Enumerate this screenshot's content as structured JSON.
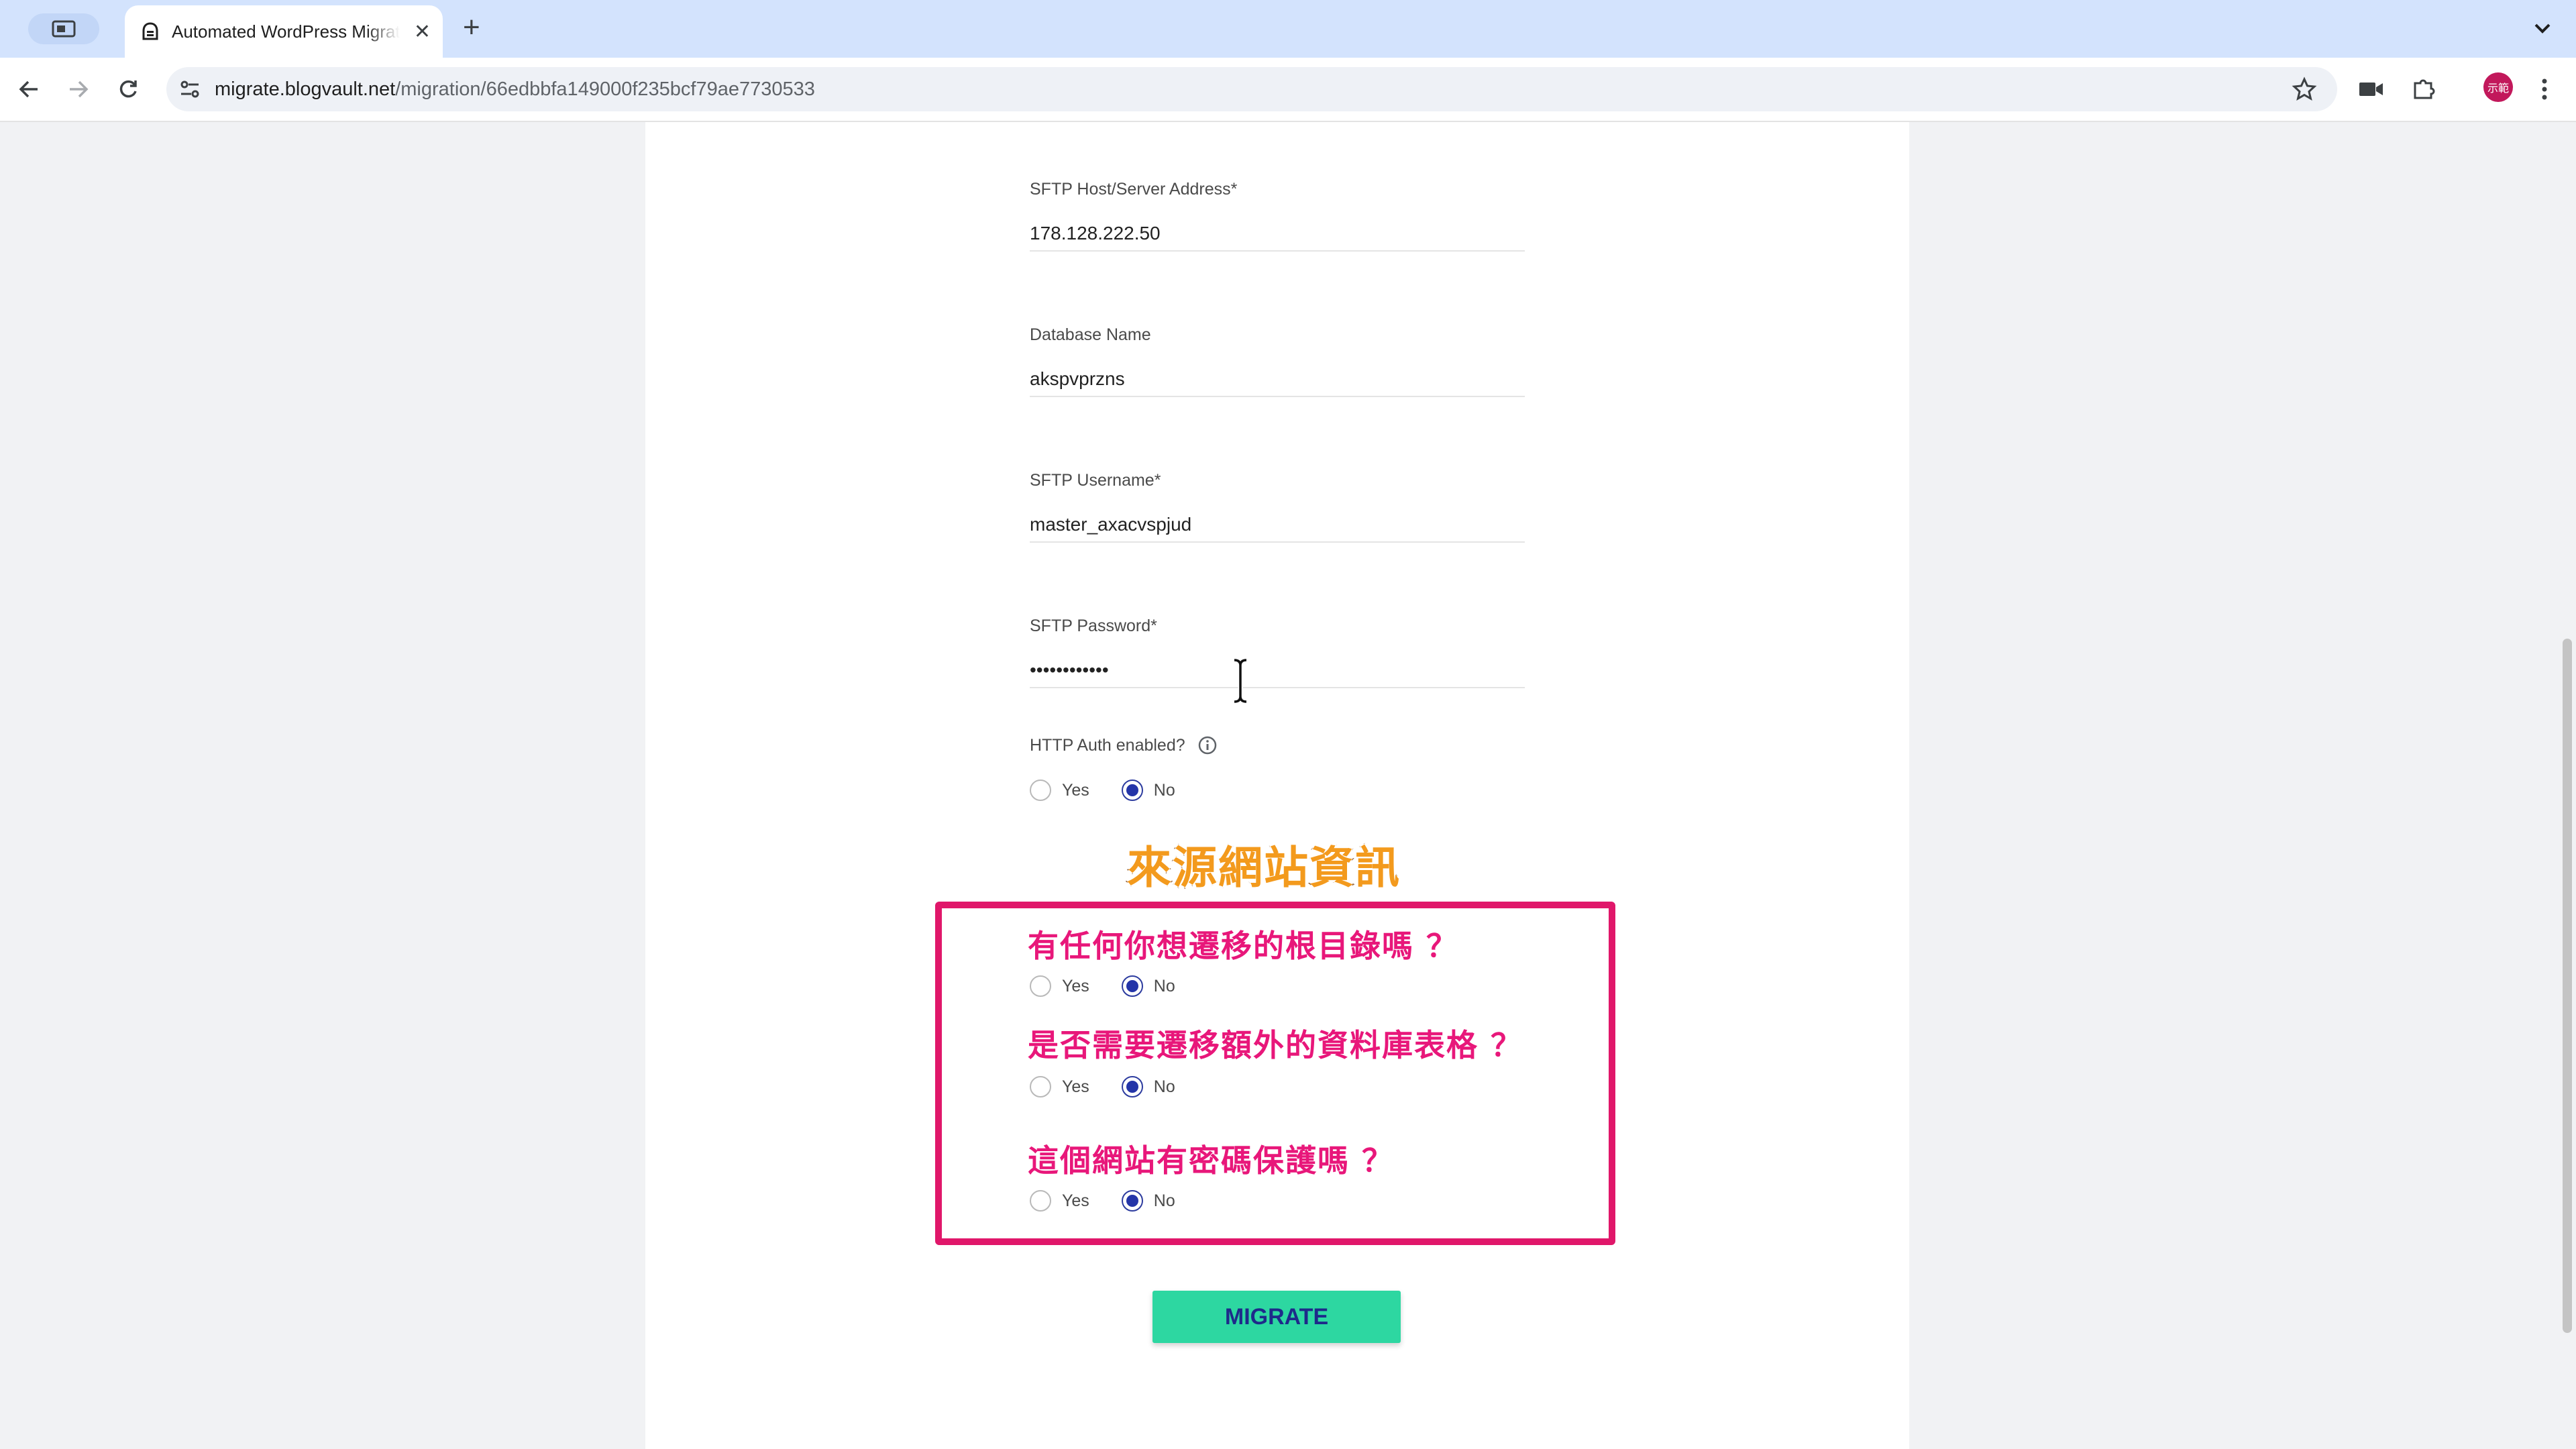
{
  "browser": {
    "tab_title": "Automated WordPress Migrat",
    "tab_close": "✕",
    "new_tab": "+",
    "url_domain": "migrate.blogvault.net",
    "url_path": "/migration/66edbbfa149000f235bcf79ae7730533",
    "profile_initials": "示範"
  },
  "form": {
    "sftp_host": {
      "label": "SFTP Host/Server Address*",
      "value": "178.128.222.50"
    },
    "db_name": {
      "label": "Database Name",
      "value": "akspvprzns"
    },
    "sftp_user": {
      "label": "SFTP Username*",
      "value": "master_axacvspjud"
    },
    "sftp_pass": {
      "label": "SFTP Password*",
      "value": "••••••••••••"
    },
    "http_auth": {
      "label": "HTTP Auth enabled?",
      "yes": "Yes",
      "no": "No",
      "selected": "No"
    },
    "root_dirs": {
      "yes": "Yes",
      "no": "No",
      "selected": "No"
    },
    "extra_tables": {
      "yes": "Yes",
      "no": "No",
      "selected": "No"
    },
    "password_protected": {
      "yes": "Yes",
      "no": "No",
      "selected": "No"
    },
    "submit_label": "MIGRATE"
  },
  "overlay": {
    "title": "來源網站資訊",
    "q1": "有任何你想遷移的根目錄嗎 ？",
    "q2": "是否需要遷移額外的資料庫表格 ？",
    "q3": "這個網站有密碼保護嗎 ？"
  },
  "colors": {
    "accent_button": "#2dd7a1",
    "radio_selected": "#2435a8",
    "highlight_border": "#e0176a",
    "overlay_question": "#e8177a",
    "overlay_title": "#f39a1d"
  }
}
